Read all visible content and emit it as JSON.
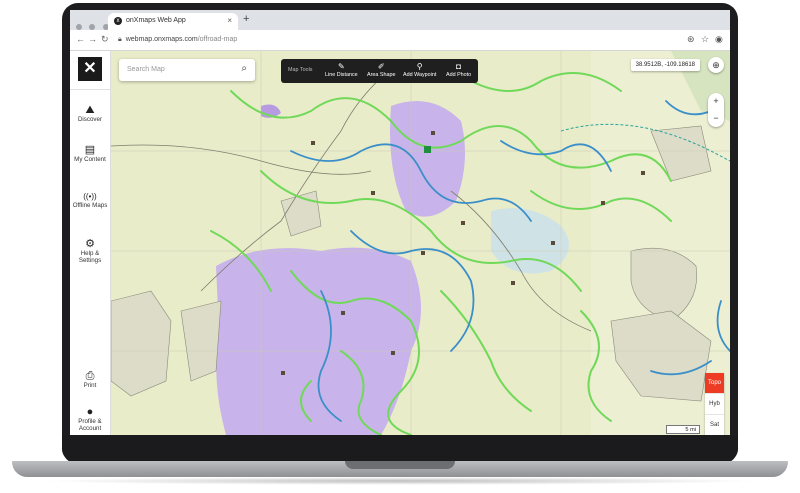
{
  "browser": {
    "tab_title": "onXmaps Web App",
    "tab_close": "×",
    "new_tab": "+",
    "url_domain": "webmap.onxmaps.com",
    "url_path": "/offroad-map"
  },
  "sidebar": {
    "logo": "✕",
    "items": [
      {
        "label": "Discover",
        "icon": "⛰"
      },
      {
        "label": "My Content",
        "icon": "▤"
      },
      {
        "label": "Offline Maps",
        "icon": "((•))"
      },
      {
        "label": "Help & Settings",
        "icon": "⚙"
      },
      {
        "label": "Print",
        "icon": "⎙"
      },
      {
        "label": "Profile & Account",
        "icon": "●"
      }
    ]
  },
  "search": {
    "placeholder": "Search Map",
    "icon": "⌕"
  },
  "map_tools": {
    "header": "Map Tools",
    "items": [
      {
        "label": "Line Distance",
        "icon": "✎"
      },
      {
        "label": "Area Shape",
        "icon": "✐"
      },
      {
        "label": "Add Waypoint",
        "icon": "⚲"
      },
      {
        "label": "Add Photo",
        "icon": "◘"
      }
    ]
  },
  "coordinates": "38.9512B, -109.18618",
  "zoom": {
    "in": "+",
    "out": "−"
  },
  "locate_icon": "⊕",
  "layers": [
    {
      "label": "Topo",
      "active": true
    },
    {
      "label": "Hyb",
      "active": false
    },
    {
      "label": "Sat",
      "active": false
    }
  ],
  "scale_label": "5 mi",
  "colors": {
    "accent": "#ee3b24",
    "sidebar_bg": "#ffffff",
    "map_base": "#e9ecc9",
    "wilderness": "#c8b4ea",
    "trail_green": "#71d95a",
    "trail_blue": "#3b8fc9"
  }
}
